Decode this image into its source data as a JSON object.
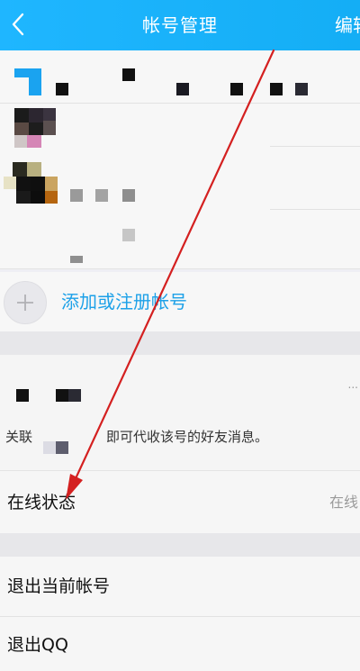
{
  "header": {
    "title": "帐号管理",
    "edit_label": "编辑",
    "background": "#14aef5"
  },
  "accounts": {
    "add_label": "添加或注册帐号",
    "accent_color": "#1da1e8"
  },
  "associated": {
    "description_prefix": "关联",
    "description_suffix": "即可代收该号的好友消息。",
    "right_partial": "..."
  },
  "settings": {
    "online_status_label": "在线状态",
    "online_status_value": "在线",
    "logout_label": "退出当前帐号",
    "quit_label": "退出QQ"
  },
  "annotation": {
    "color": "#d42020"
  }
}
